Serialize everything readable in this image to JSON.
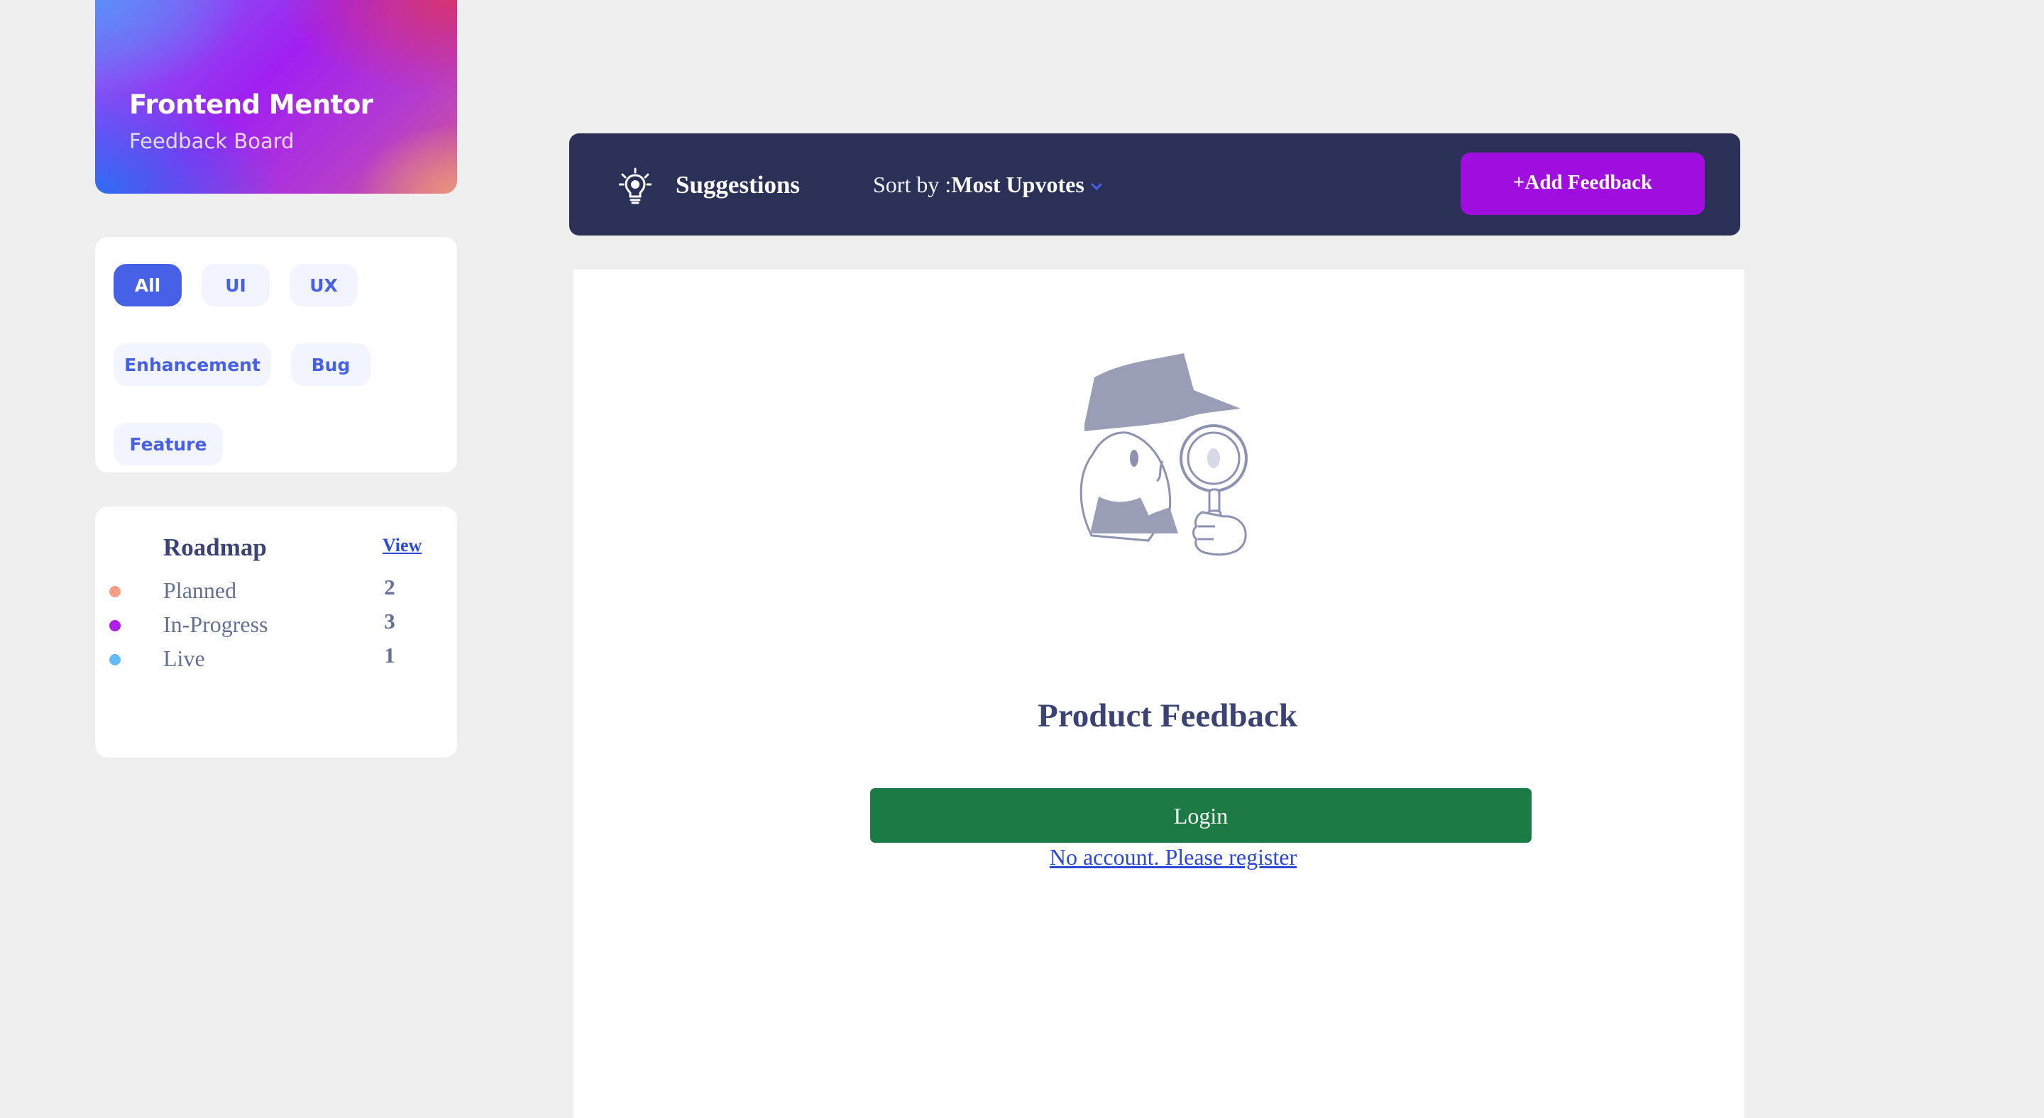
{
  "brand": {
    "title": "Frontend Mentor",
    "subtitle": "Feedback Board"
  },
  "filters": {
    "categories": [
      {
        "label": "All",
        "active": true
      },
      {
        "label": "UI",
        "active": false
      },
      {
        "label": "UX",
        "active": false
      },
      {
        "label": "Enhancement",
        "active": false
      },
      {
        "label": "Bug",
        "active": false
      },
      {
        "label": "Feature",
        "active": false
      }
    ]
  },
  "roadmap": {
    "title": "Roadmap",
    "view_label": "View",
    "items": [
      {
        "label": "Planned",
        "count": "2",
        "color": "#f49f85"
      },
      {
        "label": "In-Progress",
        "count": "3",
        "color": "#ad1fea"
      },
      {
        "label": "Live",
        "count": "1",
        "color": "#62bcfa"
      }
    ]
  },
  "header": {
    "icon": "lightbulb-icon",
    "title": "Suggestions",
    "sort_prefix": "Sort by :",
    "sort_value": "Most Upvotes",
    "sort_icon": "chevron-down-icon",
    "add_button_label": "+Add Feedback"
  },
  "main": {
    "illustration": "detective-illustration",
    "title": "Product Feedback",
    "login_label": "Login",
    "register_label": "No account. Please register"
  },
  "colors": {
    "accent_purple": "#a00ddf",
    "accent_blue": "#4661e6",
    "navy": "#2b3056",
    "login_green": "#1c7a45"
  }
}
